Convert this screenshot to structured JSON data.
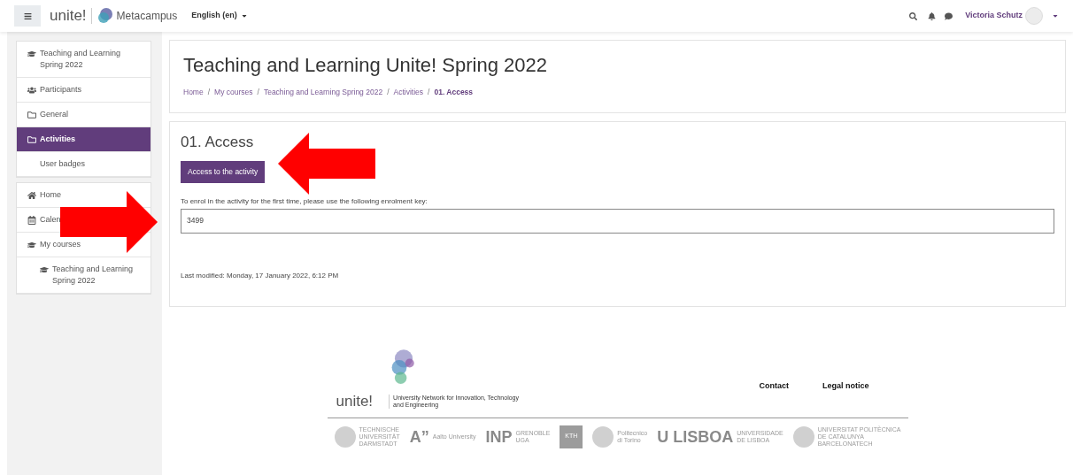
{
  "navbar": {
    "brand": "unite!",
    "site_name": "Metacampus",
    "language": "English (en)",
    "user_name": "Victoria Schutz"
  },
  "sidebar": {
    "course_items": [
      {
        "label": "Teaching and Learning Spring 2022",
        "kind": "course",
        "selected": false
      },
      {
        "label": "Participants",
        "kind": "people",
        "selected": false
      },
      {
        "label": "General",
        "kind": "section",
        "selected": false
      },
      {
        "label": "Activities",
        "kind": "section",
        "selected": true
      },
      {
        "label": "User badges",
        "kind": "plain",
        "selected": false
      }
    ],
    "site_items": [
      {
        "label": "Home",
        "kind": "home",
        "selected": false
      },
      {
        "label": "Calen",
        "kind": "calendar",
        "selected": false
      },
      {
        "label": "My courses",
        "kind": "course",
        "selected": false
      },
      {
        "label": "Teaching and Learning Spring 2022",
        "kind": "subcourse",
        "selected": false
      }
    ]
  },
  "header": {
    "title": "Teaching and Learning Unite! Spring 2022",
    "breadcrumb": [
      {
        "kind": "link",
        "label": "Home",
        "current": false
      },
      {
        "kind": "separator",
        "label": "/"
      },
      {
        "kind": "link",
        "label": "My courses",
        "current": false
      },
      {
        "kind": "separator",
        "label": "/"
      },
      {
        "kind": "link",
        "label": "Teaching and Learning Spring 2022",
        "current": false
      },
      {
        "kind": "separator",
        "label": "/"
      },
      {
        "kind": "link",
        "label": "Activities",
        "current": false
      },
      {
        "kind": "separator",
        "label": "/"
      },
      {
        "kind": "link",
        "label": "01. Access",
        "current": true
      }
    ]
  },
  "activity": {
    "title": "01. Access",
    "button": "Access to the activity",
    "key_label": "To enrol in the activity for the first time, please use the following enrolment key:",
    "key_value": "3499",
    "last_modified": "Last modified: Monday, 17 January 2022, 6:12 PM"
  },
  "footer": {
    "brand": "unite!",
    "tagline": "University Network for Innovation, Technology and Engineering",
    "links": [
      "Contact",
      "Legal notice"
    ],
    "partners": [
      {
        "kind": "seal",
        "lines": [
          "TECHNISCHE",
          "UNIVERSITÄT",
          "DARMSTADT"
        ]
      },
      {
        "kind": "mark",
        "mark": "A”",
        "lines": [
          "Aalto University"
        ]
      },
      {
        "kind": "mark",
        "mark": "INP",
        "lines": [
          "GRENOBLE",
          "UGA"
        ]
      },
      {
        "kind": "square",
        "mark": "KTH"
      },
      {
        "kind": "seal",
        "lines": [
          "Politecnico",
          "di Torino"
        ]
      },
      {
        "kind": "mark",
        "mark": "U LISBOA",
        "lines": [
          "UNIVERSIDADE",
          "DE LISBOA"
        ]
      },
      {
        "kind": "seal",
        "lines": [
          "UNIVERSITAT POLITÈCNICA",
          "DE CATALUNYA",
          "BARCELONATECH"
        ]
      }
    ]
  }
}
